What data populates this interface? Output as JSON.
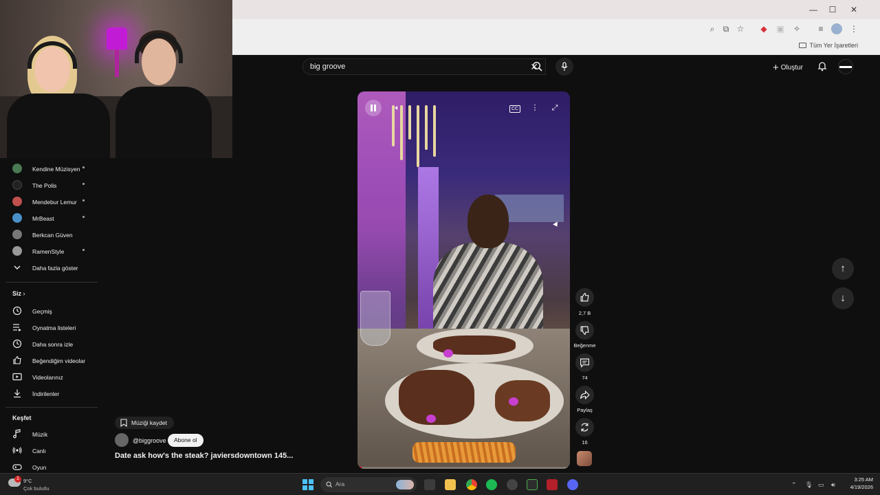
{
  "browser": {
    "bookmarks_all": "Tüm Yer İşaretleri"
  },
  "header": {
    "search_value": "big groove",
    "create_label": "Oluştur"
  },
  "sidebar": {
    "subscriptions": [
      {
        "label": "Kendine Müzisyen",
        "dot": true,
        "color": "#4a7a53"
      },
      {
        "label": "The Polis",
        "dot": true,
        "color": "#222222"
      },
      {
        "label": "Mendebur Lemur",
        "dot": true,
        "color": "#c0504d"
      },
      {
        "label": "MrBeast",
        "dot": true,
        "color": "#4a90c8"
      },
      {
        "label": "Berkcan Güven",
        "dot": false,
        "color": "#777777"
      },
      {
        "label": "RamenStyle",
        "dot": true,
        "color": "#999999"
      }
    ],
    "show_more": "Daha fazla göster",
    "you_header": "Siz",
    "you_items": [
      {
        "label": "Geçmiş",
        "icon": "history-icon"
      },
      {
        "label": "Oynatma listeleri",
        "icon": "playlist-icon"
      },
      {
        "label": "Daha sonra izle",
        "icon": "clock-icon"
      },
      {
        "label": "Beğendiğim videolar",
        "icon": "thumbs-up-icon"
      },
      {
        "label": "Videolarınız",
        "icon": "video-icon"
      },
      {
        "label": "İndirilenler",
        "icon": "download-icon"
      }
    ],
    "explore_header": "Keşfet",
    "explore_items": [
      {
        "label": "Müzik",
        "icon": "music-icon"
      },
      {
        "label": "Canlı",
        "icon": "live-icon"
      },
      {
        "label": "Oyun",
        "icon": "gaming-icon"
      }
    ]
  },
  "short": {
    "save_music": "Müziği kaydet",
    "channel_handle": "@biggroove",
    "subscribe": "Abone ol",
    "title": "Date ask how's the steak?  javiersdowntown 145...",
    "progress": 0.02
  },
  "actions": {
    "likes": "2,7 B",
    "dislike": "Beğenme",
    "comments": "74",
    "share": "Paylaş",
    "remix": "16"
  },
  "taskbar": {
    "weather_temp": "9°C",
    "weather_cond": "Çok bulutlu",
    "weather_badge": "1",
    "search_placeholder": "Ara",
    "time": "3:25 AM",
    "date": "4/19/2026"
  },
  "colors": {
    "accent_red": "#ff0033",
    "start_blue": "#4cc2ff",
    "yt_bg": "#0f0f0f"
  }
}
